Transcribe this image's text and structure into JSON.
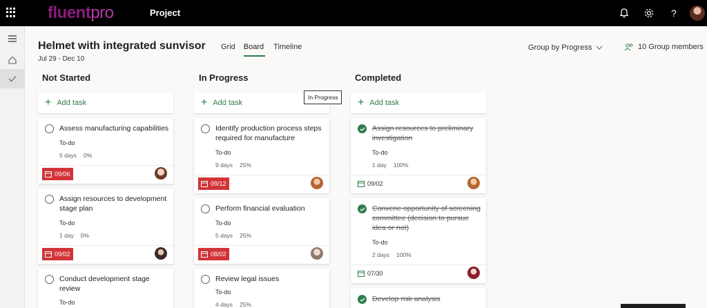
{
  "app": {
    "logo_fl": "fluent",
    "logo_pr": "pro",
    "title": "Project"
  },
  "header_icons": [
    "bell-icon",
    "gear-icon",
    "help-icon"
  ],
  "project": {
    "title": "Helmet with integrated sunvisor",
    "dates": "Jul 29 - Dec 10"
  },
  "views": [
    "Grid",
    "Board",
    "Timeline"
  ],
  "active_view": "Board",
  "group_by": "Group by Progress",
  "members": "10 Group members",
  "tooltip": "In Progress",
  "add_task_label": "Add task",
  "colors": {
    "accent": "#2e7d4a",
    "late": "#d13438",
    "topbar": "#000000"
  },
  "columns": [
    {
      "title": "Not Started",
      "cards": [
        {
          "name": "Assess manufacturing capabilities",
          "status": "To-do",
          "duration": "5 days",
          "progress": "0%",
          "date": "09/06",
          "late": true
        },
        {
          "name": "Assign resources to development stage plan",
          "status": "To-do",
          "duration": "1 day",
          "progress": "0%",
          "date": "09/02",
          "late": true
        },
        {
          "name": "Conduct development stage review",
          "status": "To-do"
        }
      ]
    },
    {
      "title": "In Progress",
      "cards": [
        {
          "name": "Identify production process steps required for manufacture",
          "status": "To-do",
          "duration": "9 days",
          "progress": "25%",
          "date": "09/12",
          "late": true
        },
        {
          "name": "Perform financial evaluation",
          "status": "To-do",
          "duration": "5 days",
          "progress": "25%",
          "date": "08/02",
          "late": true
        },
        {
          "name": "Review legal issues",
          "status": "To-do",
          "duration": "4 days",
          "progress": "25%"
        }
      ]
    },
    {
      "title": "Completed",
      "cards": [
        {
          "name": "Assign resources to preliminary investigation",
          "status": "To-do",
          "duration": "1 day",
          "progress": "100%",
          "date": "09/02",
          "late": false
        },
        {
          "name": "Convene opportunity of screening committee (decision to pursue idea or not)",
          "status": "To-do",
          "duration": "2 days",
          "progress": "100%",
          "date": "07/30",
          "late": false
        },
        {
          "name": "Develop risk analysis"
        }
      ]
    }
  ]
}
